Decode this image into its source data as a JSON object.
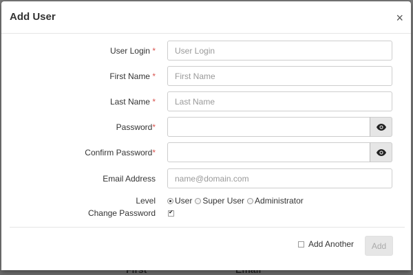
{
  "background": {
    "hint_left": "First",
    "hint_right": "Email"
  },
  "modal": {
    "title": "Add User",
    "close_glyph": "×"
  },
  "form": {
    "user_login": {
      "label": "User Login",
      "required": "*",
      "placeholder": "User Login",
      "value": ""
    },
    "first_name": {
      "label": "First Name",
      "required": "*",
      "placeholder": "First Name",
      "value": ""
    },
    "last_name": {
      "label": "Last Name",
      "required": "*",
      "placeholder": "Last Name",
      "value": ""
    },
    "password": {
      "label": "Password",
      "required": "*",
      "value": "",
      "toggle_icon": "eye-icon"
    },
    "confirm_password": {
      "label": "Confirm Password",
      "required": "*",
      "value": "",
      "toggle_icon": "eye-icon"
    },
    "email": {
      "label": "Email Address",
      "placeholder": "name@domain.com",
      "value": ""
    },
    "level": {
      "label": "Level",
      "options": [
        "User",
        "Super User",
        "Administrator"
      ],
      "selected": "User"
    },
    "change_password": {
      "label": "Change Password",
      "checked": true
    }
  },
  "footer": {
    "add_another_label": "Add Another",
    "add_another_checked": false,
    "add_button_label": "Add",
    "add_button_disabled": true
  }
}
